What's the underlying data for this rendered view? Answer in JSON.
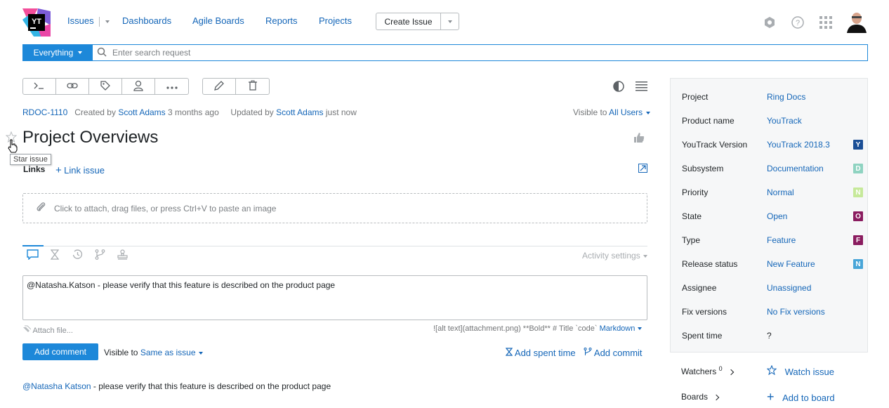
{
  "header": {
    "logo_text": "YT",
    "nav": {
      "issues": "Issues",
      "dashboards": "Dashboards",
      "agile_boards": "Agile Boards",
      "reports": "Reports",
      "projects": "Projects"
    },
    "create_issue": "Create Issue"
  },
  "search": {
    "context": "Everything",
    "placeholder": "Enter search request"
  },
  "issue": {
    "id": "RDOC-1110",
    "created_prefix": "Created by",
    "created_by": "Scott Adams",
    "created_when": "3 months ago",
    "updated_prefix": "Updated by",
    "updated_by": "Scott Adams",
    "updated_when": "just now",
    "visible_prefix": "Visible to",
    "visible_to": "All Users",
    "title": "Project Overviews",
    "star_tooltip": "Star issue",
    "links_label": "Links",
    "link_issue": "Link issue",
    "attach_hint": "Click to attach, drag files, or press Ctrl+V to paste an image"
  },
  "activity": {
    "settings": "Activity settings",
    "comment_draft": "@Natasha.Katson - please verify that this feature is described on the product page",
    "attach_file": "Attach file...",
    "markdown_hint": "![alt text](attachment.png) **Bold** # Title `code`",
    "markdown": "Markdown",
    "add_comment": "Add comment",
    "visible_prefix": "Visible to",
    "visible_value": "Same as issue",
    "add_spent_time": "Add spent time",
    "add_commit": "Add commit",
    "comment_author": "@Natasha Katson",
    "comment_text": "- please verify that this feature is described on the product page"
  },
  "fields": [
    {
      "label": "Project",
      "value": "Ring Docs",
      "badge": "",
      "color": ""
    },
    {
      "label": "Product name",
      "value": "YouTrack",
      "badge": "",
      "color": ""
    },
    {
      "label": "YouTrack Version",
      "value": "YouTrack 2018.3",
      "badge": "Y",
      "color": "#1b4f96"
    },
    {
      "label": "Subsystem",
      "value": "Documentation",
      "badge": "D",
      "color": "#8fd3c1"
    },
    {
      "label": "Priority",
      "value": "Normal",
      "badge": "N",
      "color": "#c6e99a"
    },
    {
      "label": "State",
      "value": "Open",
      "badge": "O",
      "color": "#8a1c5f"
    },
    {
      "label": "Type",
      "value": "Feature",
      "badge": "F",
      "color": "#8a1c5f"
    },
    {
      "label": "Release status",
      "value": "New Feature",
      "badge": "N",
      "color": "#48a5d8"
    },
    {
      "label": "Assignee",
      "value": "Unassigned",
      "badge": "",
      "color": ""
    },
    {
      "label": "Fix versions",
      "value": "No Fix versions",
      "badge": "",
      "color": ""
    },
    {
      "label": "Spent time",
      "value": "?",
      "badge": "",
      "color": ""
    }
  ],
  "watchers": {
    "label": "Watchers",
    "count": "0",
    "action": "Watch issue"
  },
  "boards": {
    "label": "Boards",
    "action": "Add to board"
  },
  "colors": {
    "accent": "#1d88d9",
    "link": "#1466b8"
  }
}
